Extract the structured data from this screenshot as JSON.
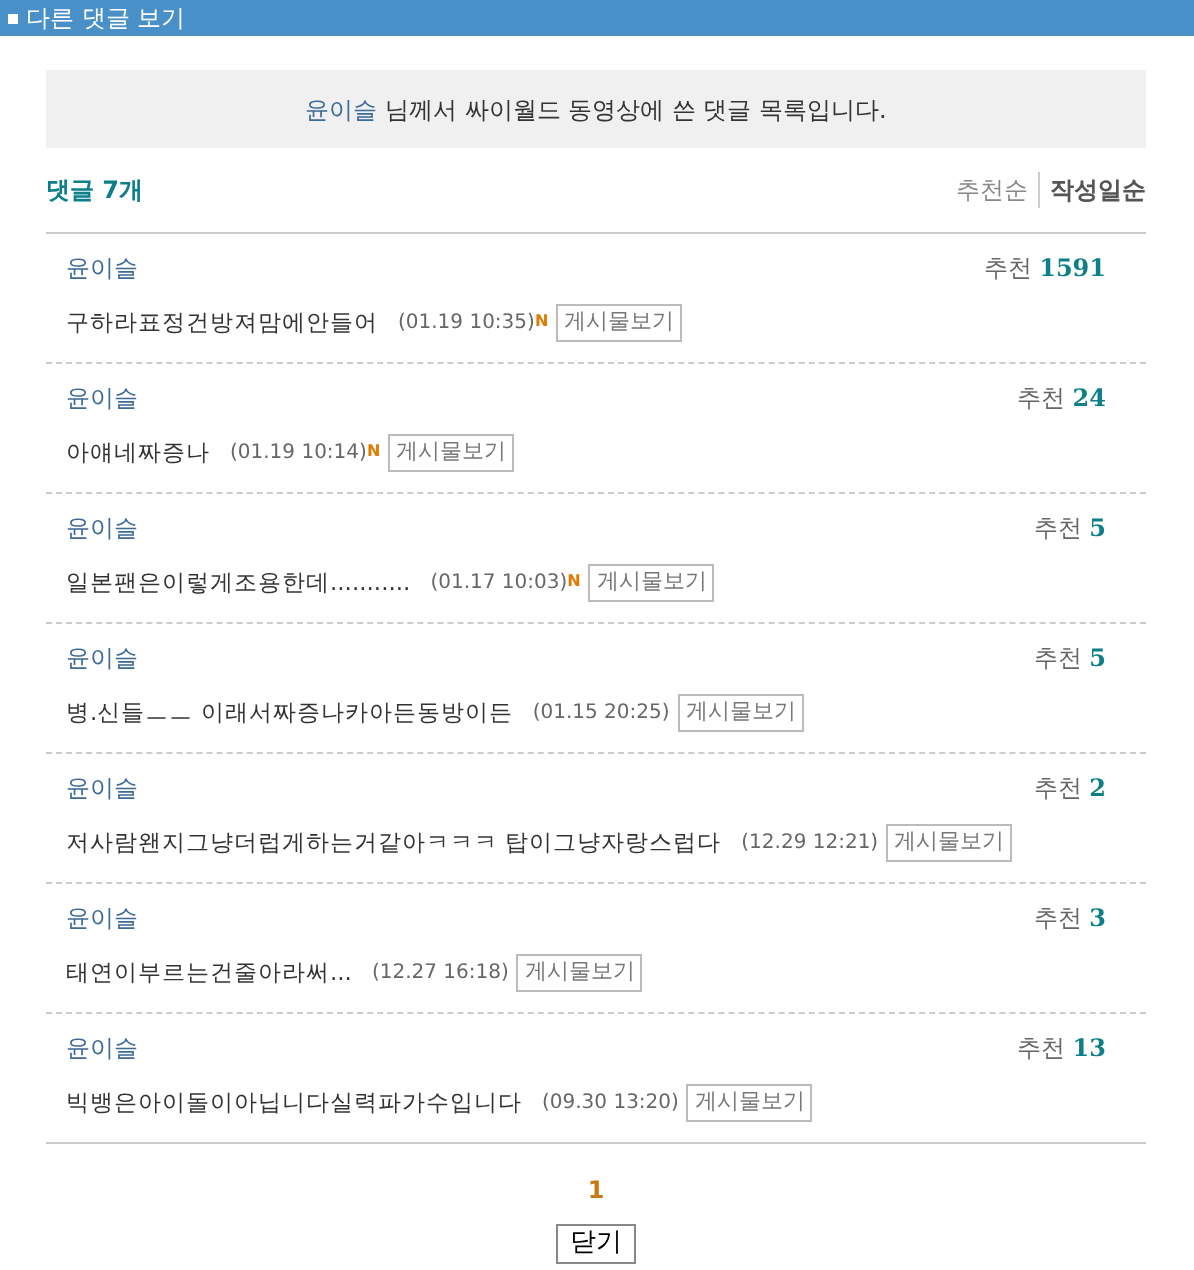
{
  "window": {
    "title": "다른 댓글 보기"
  },
  "notice": {
    "user": "윤이슬",
    "text": "님께서 싸이월드 동영상에 쓴 댓글 목록입니다."
  },
  "count": {
    "label": "댓글",
    "value": "7개"
  },
  "sort": [
    {
      "label": "추천순",
      "selected": false
    },
    {
      "label": "작성일순",
      "selected": true
    }
  ],
  "comments": [
    {
      "author": "윤이슬",
      "recommend_label": "추천",
      "recommend": "1591",
      "text": "구하라표정건방져맘에안들어",
      "date": "(01.19 10:35)",
      "new_mark": "N",
      "link": "게시물보기"
    },
    {
      "author": "윤이슬",
      "recommend_label": "추천",
      "recommend": "24",
      "text": "아얘네짜증나",
      "date": "(01.19 10:14)",
      "new_mark": "N",
      "link": "게시물보기"
    },
    {
      "author": "윤이슬",
      "recommend_label": "추천",
      "recommend": "5",
      "text": "일본팬은이렇게조용한데...........",
      "date": "(01.17 10:03)",
      "new_mark": "N",
      "link": "게시물보기"
    },
    {
      "author": "윤이슬",
      "recommend_label": "추천",
      "recommend": "5",
      "text": "병.신들ㅡㅡ 이래서짜증나카아든동방이든",
      "date": "(01.15 20:25)",
      "link": "게시물보기"
    },
    {
      "author": "윤이슬",
      "recommend_label": "추천",
      "recommend": "2",
      "text": "저사람왠지그냥더럽게하는거같아ㅋㅋㅋ 탑이그냥자랑스럽다",
      "date": "(12.29 12:21)",
      "link": "게시물보기"
    },
    {
      "author": "윤이슬",
      "recommend_label": "추천",
      "recommend": "3",
      "text": "태연이부르는건줄아라써...",
      "date": "(12.27 16:18)",
      "link": "게시물보기"
    },
    {
      "author": "윤이슬",
      "recommend_label": "추천",
      "recommend": "13",
      "text": "빅뱅은아이돌이아닙니다실력파가수입니다",
      "date": "(09.30 13:20)",
      "link": "게시물보기"
    }
  ],
  "pagination": [
    {
      "label": "1",
      "selected": true
    }
  ],
  "close_button": "닫기"
}
